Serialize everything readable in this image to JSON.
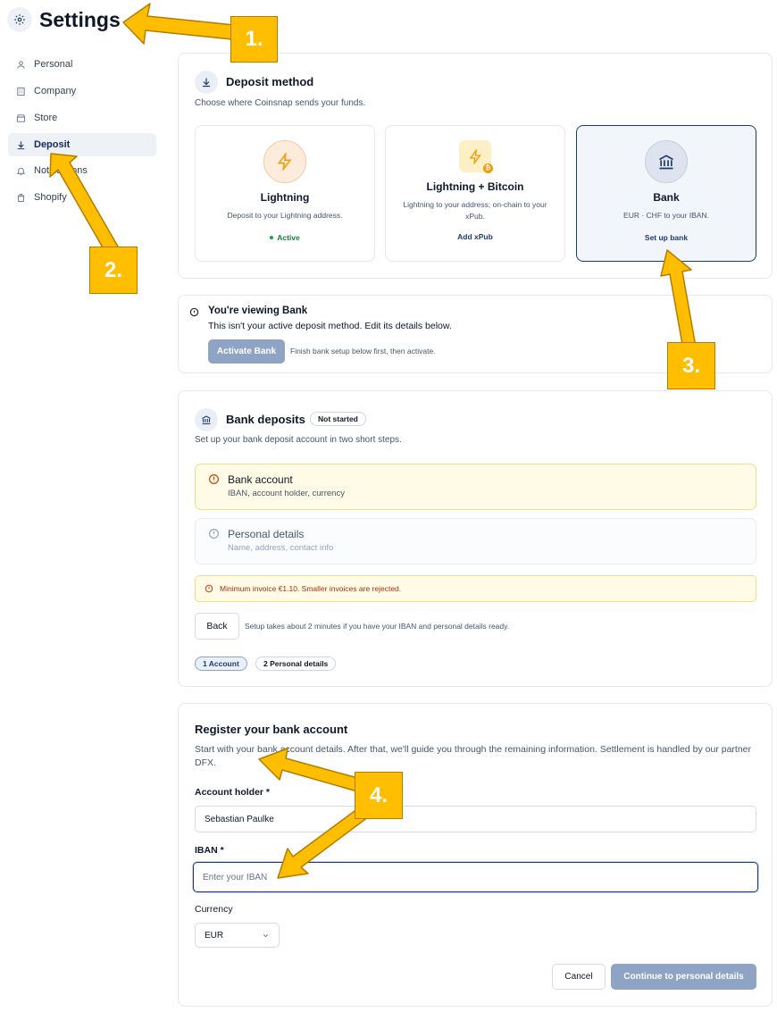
{
  "header": {
    "title": "Settings",
    "icon": "gear-icon"
  },
  "sidebar": {
    "items": [
      {
        "label": "Personal",
        "icon": "user-icon",
        "active": false
      },
      {
        "label": "Company",
        "icon": "building-icon",
        "active": false
      },
      {
        "label": "Store",
        "icon": "store-icon",
        "active": false
      },
      {
        "label": "Deposit",
        "icon": "download-icon",
        "active": true
      },
      {
        "label": "Notifications",
        "icon": "bell-icon",
        "active": false
      },
      {
        "label": "Shopify",
        "icon": "shopping-bag-icon",
        "active": false
      }
    ]
  },
  "deposit_method": {
    "title": "Deposit method",
    "subtitle": "Choose where Coinsnap sends your funds.",
    "options": [
      {
        "title": "Lightning",
        "desc": "Deposit to your Lightning address.",
        "status": "Active",
        "icon": "lightning-icon"
      },
      {
        "title": "Lightning + Bitcoin",
        "desc": "Lightning to your address; on-chain to your xPub.",
        "link": "Add xPub",
        "icon": "lightning-bitcoin-icon"
      },
      {
        "title": "Bank",
        "desc": "EUR · CHF to your IBAN.",
        "link": "Set up bank",
        "icon": "bank-icon",
        "selected": true
      }
    ]
  },
  "viewing_notice": {
    "title": "You're viewing Bank",
    "text": "This isn't your active deposit method. Edit its details below.",
    "button": "Activate Bank",
    "hint": "Finish bank setup below first, then activate."
  },
  "bank_deposits": {
    "title": "Bank deposits",
    "badge": "Not started",
    "subtitle": "Set up your bank deposit account in two short steps.",
    "steps": [
      {
        "title": "Bank account",
        "sub": "IBAN, account holder, currency"
      },
      {
        "title": "Personal details",
        "sub": "Name, address, contact info"
      }
    ],
    "warning": "Minimum invoice €1.10. Smaller invoices are rejected.",
    "back_button": "Back",
    "back_hint": "Setup takes about 2 minutes if you have your IBAN and personal details ready.",
    "pills": [
      "1 Account",
      "2 Personal details"
    ]
  },
  "register": {
    "title": "Register your bank account",
    "desc": "Start with your bank account details. After that, we'll guide you through the remaining information. Settlement is handled by our partner DFX.",
    "holder_label": "Account holder *",
    "holder_value": "Sebastian Paulke",
    "iban_label": "IBAN *",
    "iban_placeholder": "Enter your IBAN",
    "currency_label": "Currency",
    "currency_value": "EUR",
    "cancel": "Cancel",
    "continue": "Continue to personal details"
  },
  "annotations": [
    "1.",
    "2.",
    "3.",
    "4."
  ],
  "colors": {
    "accent": "#1e3a6e",
    "annotation": "#ffbe00",
    "warning_bg": "#fffbe6",
    "lightning": "#f59e0b",
    "success": "#16a34a"
  }
}
